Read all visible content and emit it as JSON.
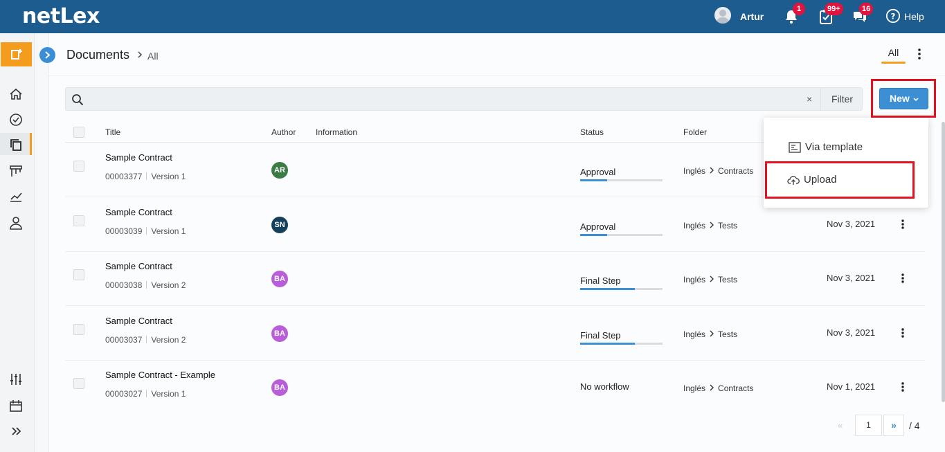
{
  "app": {
    "logo": "netLex"
  },
  "topbar": {
    "user_name": "Artur",
    "notifications_count": "1",
    "tasks_count": "99+",
    "messages_count": "16",
    "help_label": "Help"
  },
  "header": {
    "title": "Documents",
    "breadcrumb_current": "All",
    "tab_all": "All"
  },
  "search": {
    "placeholder": "",
    "clear_label": "×",
    "filter_label": "Filter"
  },
  "new_button": {
    "label": "New"
  },
  "dropdown": {
    "items": [
      "Via template",
      "Upload"
    ]
  },
  "table": {
    "headers": {
      "title": "Title",
      "author": "Author",
      "information": "Information",
      "status": "Status",
      "folder": "Folder"
    },
    "rows": [
      {
        "title": "Sample Contract",
        "id": "00003377",
        "version": "Version 1",
        "author_initials": "AR",
        "author_color": "#3a7d44",
        "status": "Approval",
        "progress": 0.33,
        "folder_root": "Inglés",
        "folder_sub": "Contracts",
        "date": ""
      },
      {
        "title": "Sample Contract",
        "id": "00003039",
        "version": "Version 1",
        "author_initials": "SN",
        "author_color": "#14405e",
        "status": "Approval",
        "progress": 0.33,
        "folder_root": "Inglés",
        "folder_sub": "Tests",
        "date": "Nov 3, 2021"
      },
      {
        "title": "Sample Contract",
        "id": "00003038",
        "version": "Version 2",
        "author_initials": "BA",
        "author_color": "#b95ed8",
        "status": "Final Step",
        "progress": 0.66,
        "folder_root": "Inglés",
        "folder_sub": "Tests",
        "date": "Nov 3, 2021"
      },
      {
        "title": "Sample Contract",
        "id": "00003037",
        "version": "Version 2",
        "author_initials": "BA",
        "author_color": "#b95ed8",
        "status": "Final Step",
        "progress": 0.66,
        "folder_root": "Inglés",
        "folder_sub": "Tests",
        "date": "Nov 3, 2021"
      },
      {
        "title": "Sample Contract - Example",
        "id": "00003027",
        "version": "Version 1",
        "author_initials": "BA",
        "author_color": "#b95ed8",
        "status": "No workflow",
        "progress": null,
        "folder_root": "Inglés",
        "folder_sub": "Contracts",
        "date": "Nov 1, 2021"
      }
    ]
  },
  "pagination": {
    "prev": "«",
    "current": "1",
    "next": "»",
    "total": "/ 4"
  },
  "colors": {
    "topbar": "#1d5c8e",
    "accent_orange": "#f39c1e",
    "primary_blue": "#3d8fd4",
    "badge_red": "#e2133d",
    "highlight_red": "#e3121e"
  },
  "sidebar_icons": [
    "new-document-icon",
    "home-icon",
    "dashboard-icon",
    "documents-icon",
    "board-icon",
    "analytics-icon",
    "user-icon",
    "settings-sliders-icon",
    "calendar-icon",
    "expand-icon"
  ]
}
